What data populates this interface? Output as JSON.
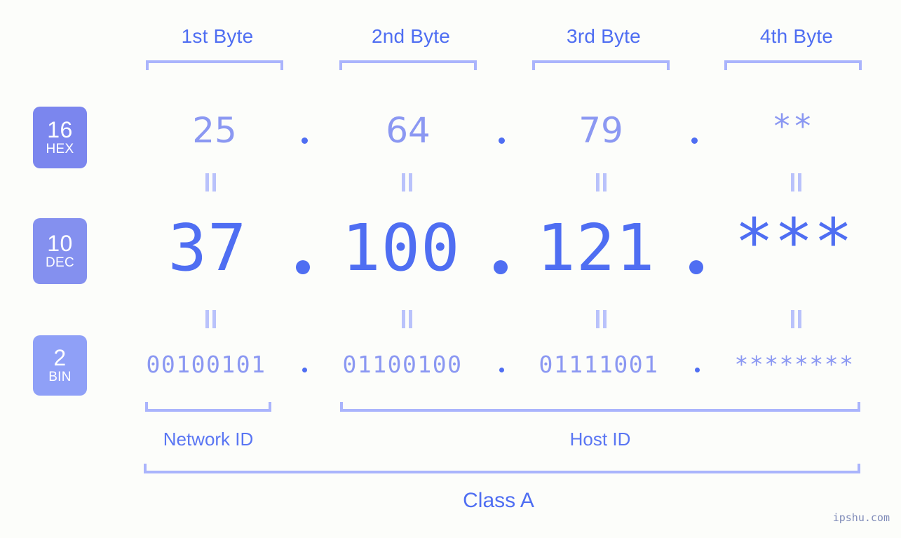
{
  "colors": {
    "background": "#fcfdfa",
    "accent_dark": "#4f6ef2",
    "accent_light": "#8b98f2",
    "bracket": "#aab4fc",
    "badge_hex": "#7b86ee",
    "badge_dec": "#8490ef",
    "badge_bin": "#8fa0f7",
    "badge_text": "#ffffff"
  },
  "byte_headers": [
    {
      "label": "1st Byte"
    },
    {
      "label": "2nd Byte"
    },
    {
      "label": "3rd Byte"
    },
    {
      "label": "4th Byte"
    }
  ],
  "rows": [
    {
      "badge_number": "16",
      "badge_system": "HEX",
      "values": [
        "25",
        "64",
        "79",
        "**"
      ],
      "separator": "."
    },
    {
      "badge_number": "10",
      "badge_system": "DEC",
      "values": [
        "37",
        "100",
        "121",
        "***"
      ],
      "separator": "."
    },
    {
      "badge_number": "2",
      "badge_system": "BIN",
      "values": [
        "00100101",
        "01100100",
        "01111001",
        "********"
      ],
      "separator": "."
    }
  ],
  "equals_mark": "=",
  "regions": [
    {
      "label": "Network ID"
    },
    {
      "label": "Host ID"
    }
  ],
  "class": {
    "label": "Class A"
  },
  "watermark": {
    "text": "ipshu.com"
  }
}
